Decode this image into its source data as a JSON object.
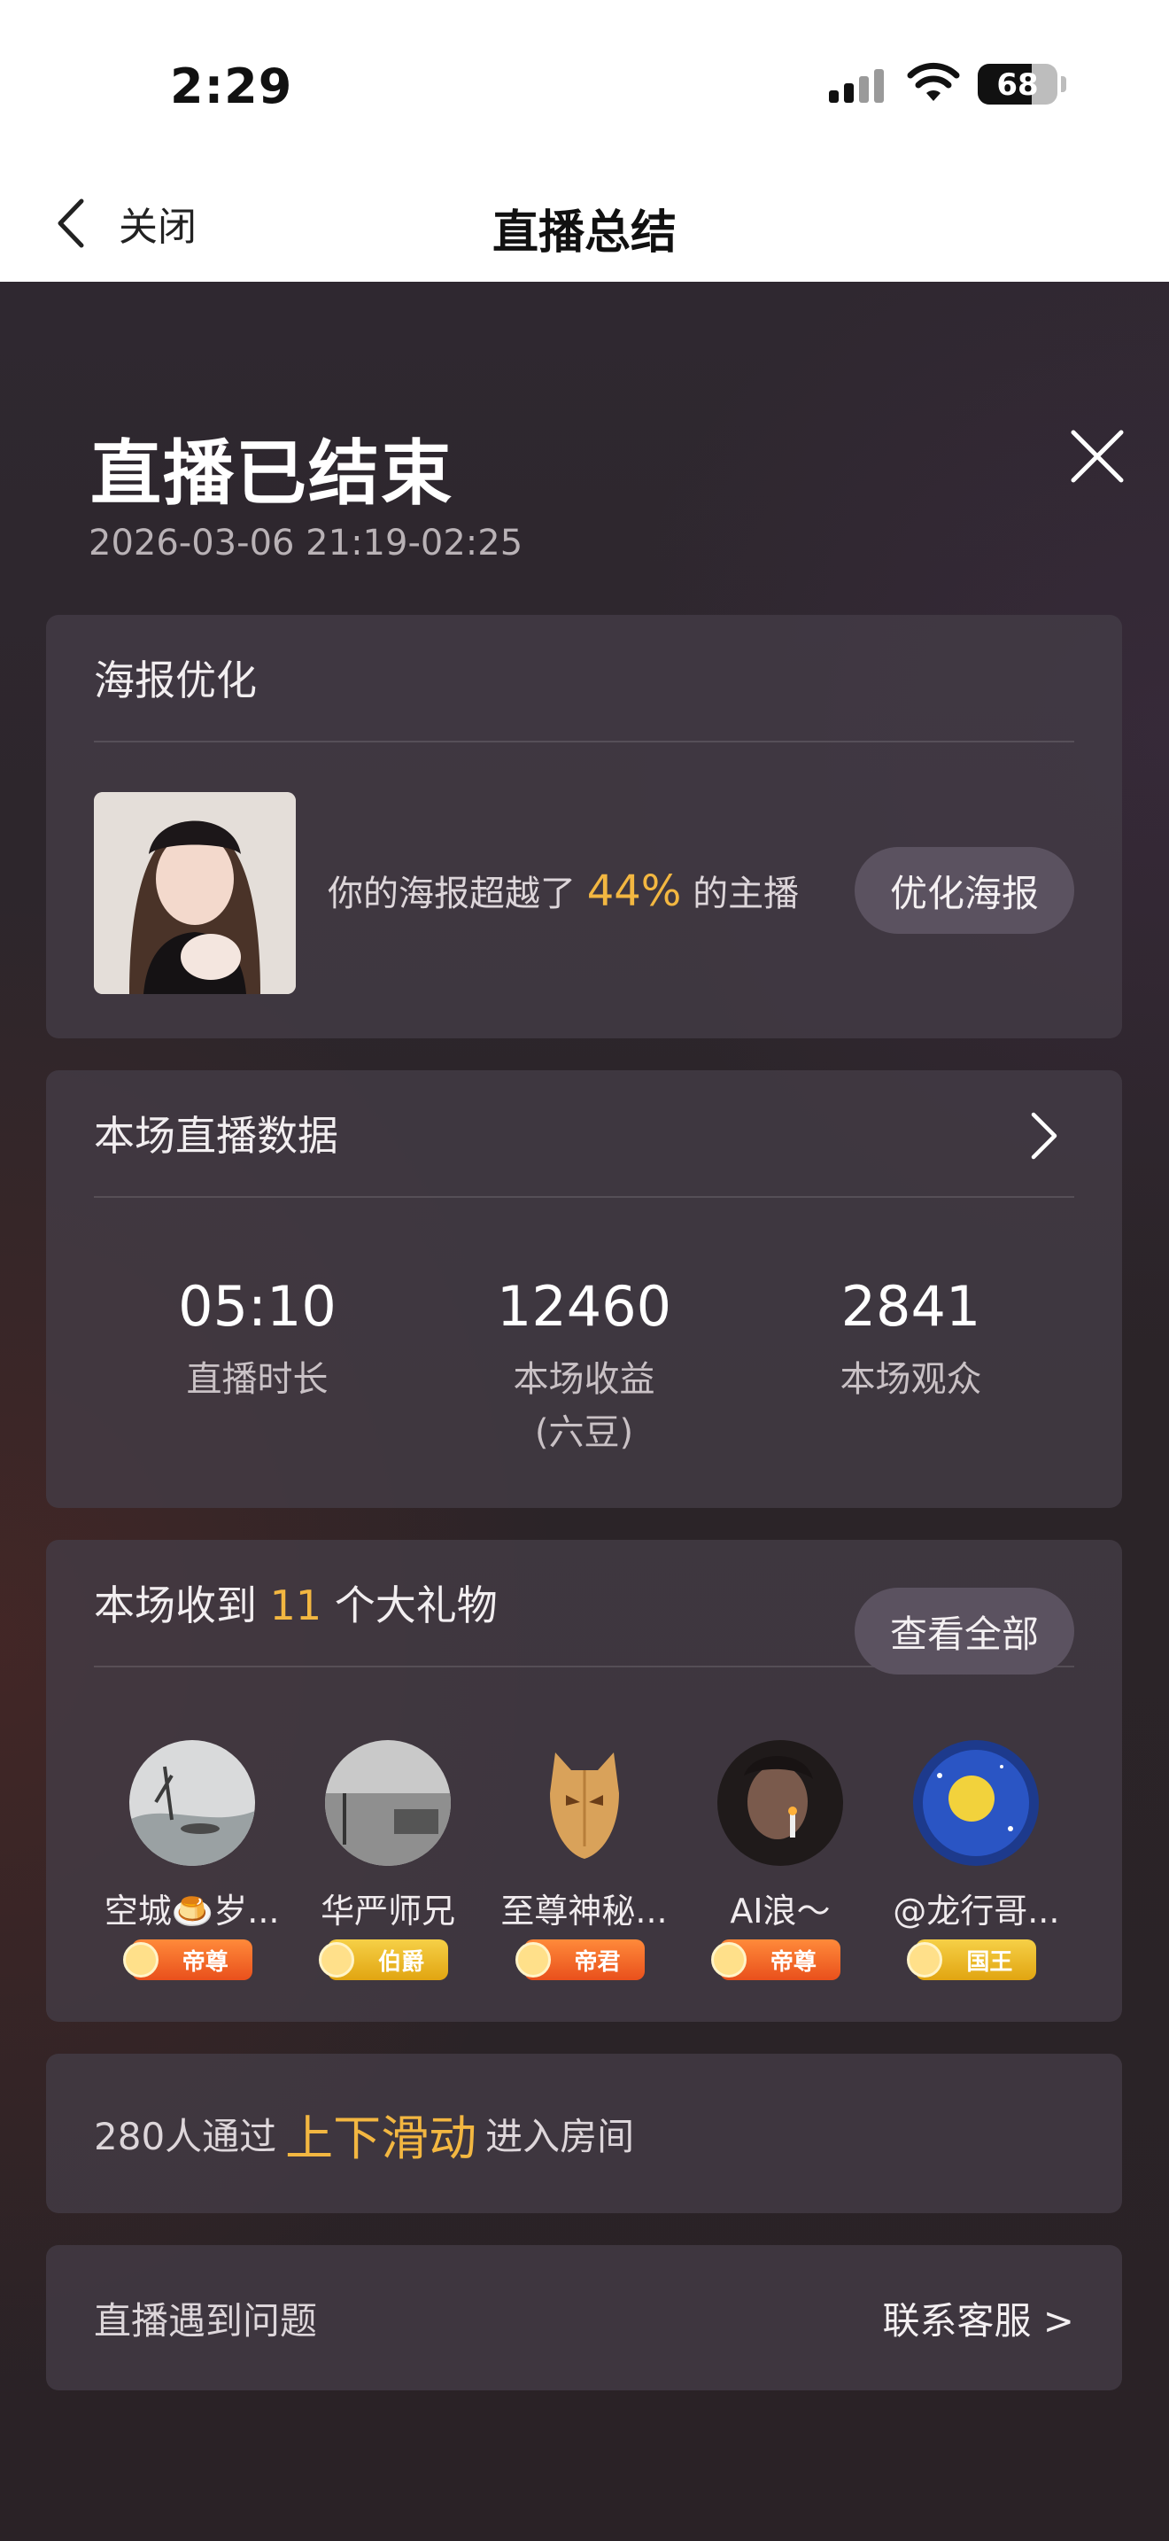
{
  "status_bar": {
    "time": "2:29",
    "battery": "68",
    "battery_level": 0.68
  },
  "nav": {
    "back_label": "关闭",
    "title": "直播总结"
  },
  "header": {
    "title": "直播已结束",
    "time_range": "2026-03-06 21:19-02:25"
  },
  "poster": {
    "heading": "海报优化",
    "text_before": "你的海报超越了",
    "percent": "44%",
    "text_after": "的主播",
    "button": "优化海报"
  },
  "stats_section": {
    "heading": "本场直播数据",
    "items": [
      {
        "value": "05:10",
        "label": "直播时长"
      },
      {
        "value": "12460",
        "label": "本场收益\n(六豆)"
      },
      {
        "value": "2841",
        "label": "本场观众"
      }
    ]
  },
  "gifts": {
    "heading_before": "本场收到",
    "count": "11",
    "heading_after": "个大礼物",
    "view_all": "查看全部",
    "givers": [
      {
        "name": "空城🍮岁...",
        "badge": "帝尊",
        "badge_color": "#f06a2a"
      },
      {
        "name": "华严师兄",
        "badge": "伯爵",
        "badge_color": "#ebb92c"
      },
      {
        "name": "至尊神秘...",
        "badge": "帝君",
        "badge_color": "#f06a2a"
      },
      {
        "name": "AI浪～",
        "badge": "帝尊",
        "badge_color": "#f06a2a"
      },
      {
        "name": "@龙行哥...",
        "badge": "国王",
        "badge_color": "#ebb92c"
      }
    ]
  },
  "swipe": {
    "before": "280人通过",
    "highlight": "上下滑动",
    "after": "进入房间"
  },
  "help": {
    "label": "直播遇到问题",
    "link": "联系客服 >"
  },
  "colors": {
    "accent": "#f3b741",
    "card": "#443c46",
    "background": "#2a2327"
  }
}
